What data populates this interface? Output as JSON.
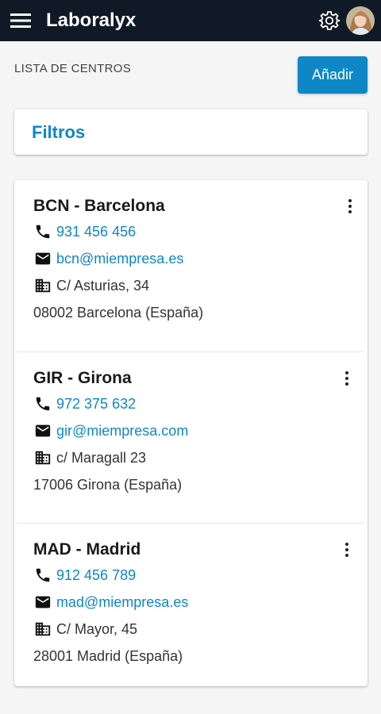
{
  "app": {
    "title": "Laboralyx"
  },
  "page": {
    "header": "LISTA DE CENTROS",
    "add_label": "Añadir"
  },
  "filters": {
    "label": "Filtros"
  },
  "colors": {
    "accent": "#0e87c7",
    "topbar": "#0f1a26"
  },
  "icons": {
    "menu": "hamburger-icon",
    "settings": "gear-icon",
    "phone": "phone-icon",
    "email": "email-icon",
    "address": "building-icon",
    "more": "more-vert-icon"
  },
  "centers": [
    {
      "name": "BCN - Barcelona",
      "phone": "931 456 456",
      "email": "bcn@miempresa.es",
      "address": "C/ Asturias, 34",
      "city": "08002 Barcelona (España)"
    },
    {
      "name": "GIR - Girona",
      "phone": "972 375 632",
      "email": "gir@miempresa.com",
      "address": "c/ Maragall 23",
      "city": "17006 Girona (España)"
    },
    {
      "name": "MAD - Madrid",
      "phone": "912 456 789",
      "email": "mad@miempresa.es",
      "address": "C/ Mayor, 45",
      "city": "28001 Madrid (España)"
    }
  ]
}
